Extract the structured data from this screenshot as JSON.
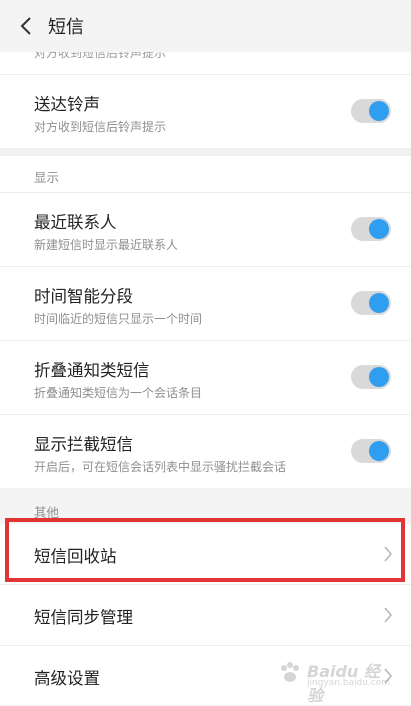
{
  "header": {
    "title": "短信",
    "back_icon": "chevron-left-icon"
  },
  "top_section": {
    "cut_text": "对方收到短信后铃声提示",
    "rows": [
      {
        "title": "送达铃声",
        "subtitle": "对方收到短信后铃声提示",
        "enabled": true
      }
    ]
  },
  "display_section": {
    "label": "显示",
    "rows": [
      {
        "title": "最近联系人",
        "subtitle": "新建短信时显示最近联系人",
        "enabled": true
      },
      {
        "title": "时间智能分段",
        "subtitle": "时间临近的短信只显示一个时间",
        "enabled": true
      },
      {
        "title": "折叠通知类短信",
        "subtitle": "折叠通知类短信为一个会话条目",
        "enabled": true
      },
      {
        "title": "显示拦截短信",
        "subtitle": "开启后，可在短信会话列表中显示骚扰拦截会话",
        "enabled": true
      }
    ]
  },
  "other_section": {
    "label": "其他",
    "items": [
      {
        "label": "短信回收站"
      },
      {
        "label": "短信同步管理"
      },
      {
        "label": "高级设置"
      }
    ]
  },
  "watermark": {
    "text": "Baidu 经验",
    "sub": "jingyan.baidu.com"
  },
  "colors": {
    "accent": "#2f9ef0",
    "highlight": "#e03437",
    "background": "#f4f4f4"
  }
}
